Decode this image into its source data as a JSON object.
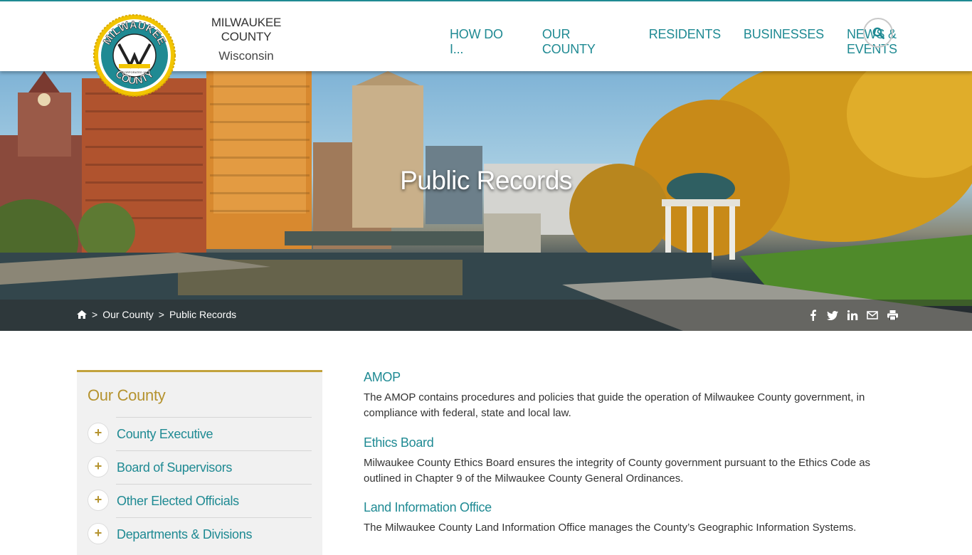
{
  "header": {
    "brand_name": "MILWAUKEE COUNTY",
    "brand_state": "Wisconsin",
    "nav": [
      "HOW DO I...",
      "OUR COUNTY",
      "RESIDENTS",
      "BUSINESSES",
      "NEWS & EVENTS"
    ],
    "search_icon": "search-icon"
  },
  "logo": {
    "top_text": "MILWAUKEE",
    "bottom_text": "COUNTY",
    "inner_text": "INCORPORATED 1835"
  },
  "hero": {
    "title": "Public Records",
    "breadcrumb": [
      "Our County",
      "Public Records"
    ],
    "share_icons": [
      "facebook-icon",
      "twitter-icon",
      "linkedin-icon",
      "email-icon",
      "print-icon"
    ]
  },
  "sidebar": {
    "title": "Our County",
    "items": [
      "County Executive",
      "Board of Supervisors",
      "Other Elected Officials",
      "Departments & Divisions"
    ]
  },
  "content": {
    "entries": [
      {
        "title": "AMOP",
        "text": "The AMOP contains procedures and policies that guide the operation of Milwaukee County government, in compliance with federal, state and local law."
      },
      {
        "title": "Ethics Board",
        "text": "Milwaukee County Ethics Board ensures the integrity of County government pursuant to the Ethics Code as outlined in Chapter 9 of the Milwaukee County General Ordinances."
      },
      {
        "title": "Land Information Office",
        "text": "The Milwaukee County Land Information Office manages the County’s Geographic Information Systems."
      }
    ]
  },
  "colors": {
    "teal": "#1f8a93",
    "gold": "#b5932f"
  }
}
